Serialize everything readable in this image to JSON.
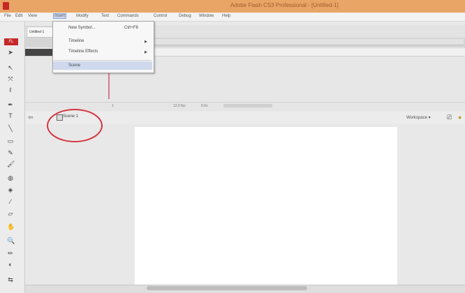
{
  "window": {
    "title": "Adobe Flash CS3 Professional - [Untitled-1]"
  },
  "menubar": {
    "items": [
      {
        "label": "File"
      },
      {
        "label": "Edit"
      },
      {
        "label": "View"
      },
      {
        "label": "Insert",
        "active": true
      },
      {
        "label": "Modify"
      },
      {
        "label": "Text"
      },
      {
        "label": "Commands"
      },
      {
        "label": "Control"
      },
      {
        "label": "Debug"
      },
      {
        "label": "Window"
      },
      {
        "label": "Help"
      }
    ]
  },
  "insert_menu": {
    "items": [
      {
        "label": "New Symbol...",
        "shortcut": "Ctrl+F8"
      },
      {
        "label": "Timeline",
        "submenu": true
      },
      {
        "label": "Timeline Effects",
        "submenu": true
      },
      {
        "label": "Scene",
        "highlighted": true
      }
    ]
  },
  "document": {
    "tab_label": "Untitled-1"
  },
  "editbar": {
    "scene_label": "Scene 1",
    "workspace_label": "Workspace ▾"
  },
  "timeline": {
    "status_fps": "12.0 fps",
    "status_time": "0.0s",
    "status_frame": "1"
  },
  "annotation": {
    "circle_color": "#d4343f"
  },
  "tools": {
    "header": "FL",
    "icons": [
      "selection-arrow",
      "subselection-arrow",
      "free-transform",
      "lasso",
      "pen",
      "text",
      "line",
      "rectangle",
      "pencil",
      "brush",
      "ink-bottle",
      "paint-bucket",
      "eyedropper",
      "eraser",
      "hand",
      "zoom",
      "stroke-color",
      "fill-color",
      "swap-colors"
    ]
  },
  "colors": {
    "titlebar": "#e8a566",
    "menu_highlight": "#cfd9ee",
    "brand_red": "#c62828"
  }
}
